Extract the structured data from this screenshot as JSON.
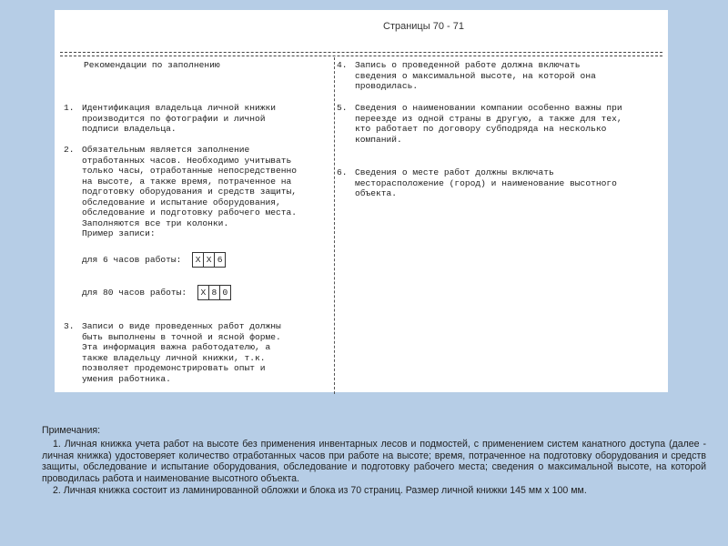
{
  "header": {
    "pages": "Страницы 70 - 71"
  },
  "left": {
    "title": "Рекомендации по заполнению",
    "item1": {
      "num": "1.",
      "lines": [
        "Идентификация владельца личной книжки",
        "производится по фотографии и личной",
        "подписи владельца."
      ]
    },
    "item2": {
      "num": "2.",
      "lines": [
        "Обязательным является заполнение",
        "отработанных часов. Необходимо учитывать",
        "только часы, отработанные непосредственно",
        "на высоте, а также время, потраченное на",
        "подготовку оборудования и средств защиты,",
        "обследование и испытание оборудования,",
        "обследование и подготовку рабочего места.",
        "Заполняются все три колонки.",
        "Пример записи:"
      ],
      "example1_label": "для 6 часов работы:",
      "example1_cells": [
        "X",
        "X",
        "6"
      ],
      "example2_label": "для 80 часов работы:",
      "example2_cells": [
        "X",
        "8",
        "0"
      ]
    },
    "item3": {
      "num": "3.",
      "lines": [
        "Записи о виде проведенных работ должны",
        "быть выполнены в точной и ясной форме.",
        "Эта информация важна работодателю, а",
        "также владельцу личной книжки, т.к.",
        "позволяет продемонстрировать опыт и",
        "умения работника."
      ]
    }
  },
  "right": {
    "item4": {
      "num": "4.",
      "lines": [
        "Запись о проведенной работе должна включать",
        "сведения о максимальной высоте, на которой она",
        "проводилась."
      ]
    },
    "item5": {
      "num": "5.",
      "lines": [
        "Сведения о наименовании компании особенно важны при",
        "переезде из одной страны в другую, а также для тех,",
        "кто работает по договору субподряда на несколько",
        "компаний."
      ]
    },
    "item6": {
      "num": "6.",
      "lines": [
        "Сведения о месте работ должны включать",
        "месторасположение (город) и наименование высотного",
        "объекта."
      ]
    }
  },
  "notes": {
    "title": "Примечания:",
    "note1": "1. Личная книжка учета работ на высоте без применения инвентарных лесов и подмостей, с применением систем канатного доступа (далее - личная книжка) удостоверяет количество отработанных часов при работе на высоте; время, потраченное на подготовку оборудования и средств защиты, обследование и испытание оборудования, обследование и подготовку рабочего места; сведения о максимальной высоте, на которой проводилась работа и наименование высотного объекта.",
    "note2": "2. Личная книжка состоит из ламинированной обложки и блока из 70 страниц. Размер личной книжки 145 мм х 100 мм."
  }
}
